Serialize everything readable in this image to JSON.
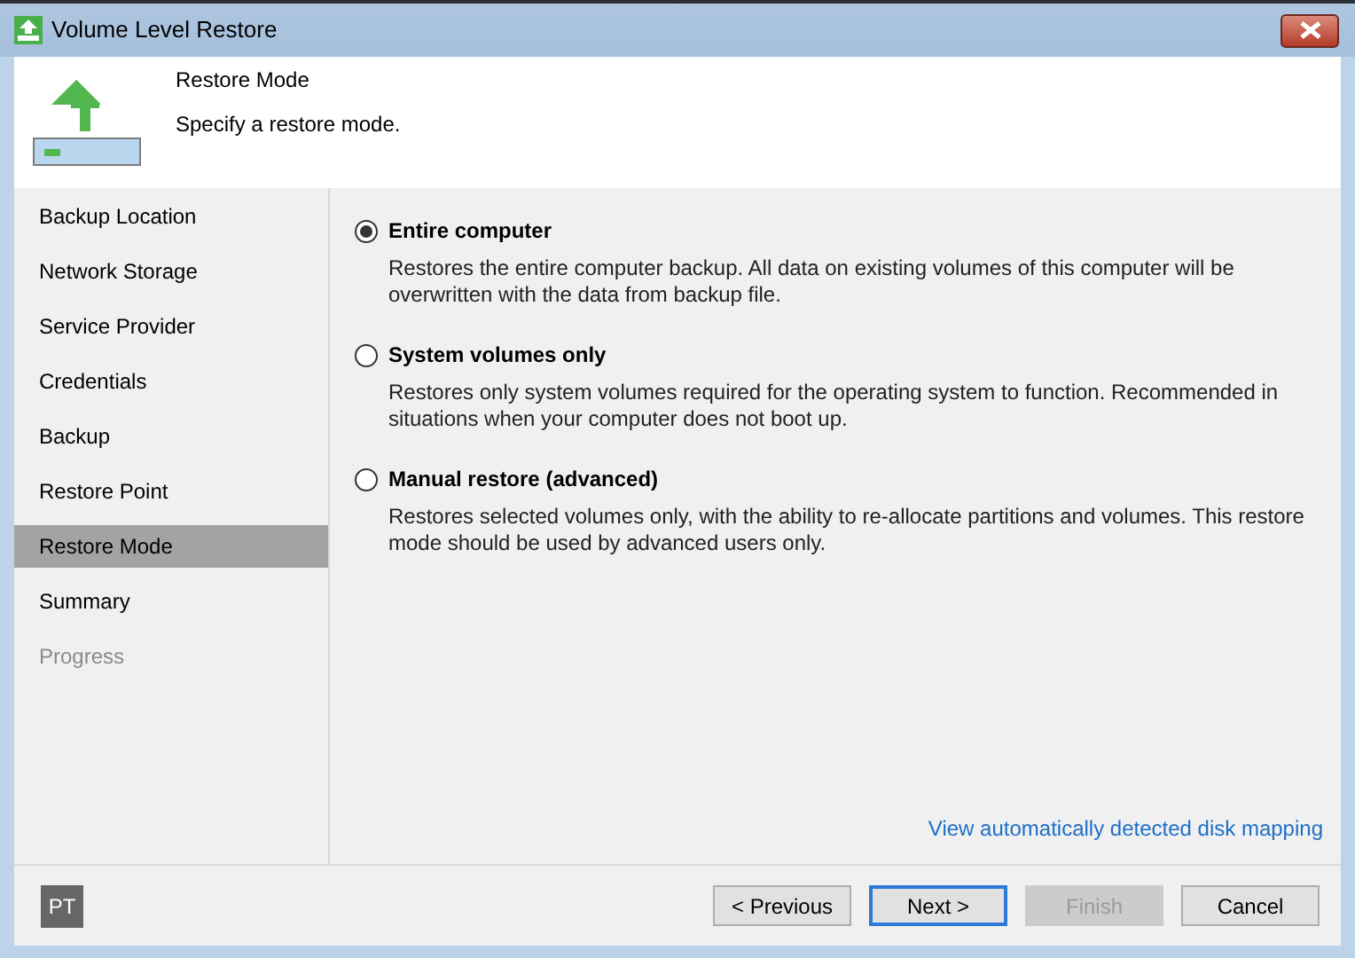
{
  "window": {
    "title": "Volume Level Restore"
  },
  "header": {
    "title": "Restore Mode",
    "subtitle": "Specify a restore mode."
  },
  "sidebar": {
    "items": [
      {
        "label": "Backup Location",
        "selected": false,
        "disabled": false
      },
      {
        "label": "Network Storage",
        "selected": false,
        "disabled": false
      },
      {
        "label": "Service Provider",
        "selected": false,
        "disabled": false
      },
      {
        "label": "Credentials",
        "selected": false,
        "disabled": false
      },
      {
        "label": "Backup",
        "selected": false,
        "disabled": false
      },
      {
        "label": "Restore Point",
        "selected": false,
        "disabled": false
      },
      {
        "label": "Restore Mode",
        "selected": true,
        "disabled": false
      },
      {
        "label": "Summary",
        "selected": false,
        "disabled": false
      },
      {
        "label": "Progress",
        "selected": false,
        "disabled": true
      }
    ]
  },
  "options": [
    {
      "label": "Entire computer",
      "description": "Restores the entire computer backup. All data on existing volumes of this computer will be overwritten with the data from backup file.",
      "selected": true
    },
    {
      "label": "System volumes only",
      "description": "Restores only system volumes required for the operating system to function. Recommended in situations when your computer does not boot up.",
      "selected": false
    },
    {
      "label": "Manual restore (advanced)",
      "description": "Restores selected volumes only, with the ability to re-allocate partitions and volumes. This restore mode should be used by advanced users only.",
      "selected": false
    }
  ],
  "link": "View automatically detected disk mapping",
  "footer": {
    "badge": "PT",
    "buttons": [
      {
        "label": "< Previous",
        "disabled": false,
        "focused": false
      },
      {
        "label": "Next >",
        "disabled": false,
        "focused": true
      },
      {
        "label": "Finish",
        "disabled": true,
        "focused": false
      },
      {
        "label": "Cancel",
        "disabled": false,
        "focused": false
      }
    ]
  }
}
